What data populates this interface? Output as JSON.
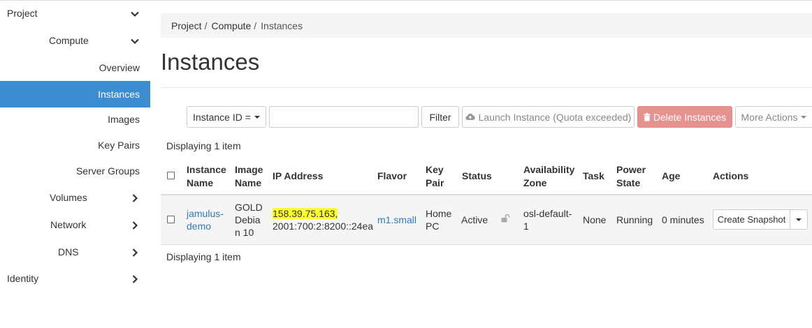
{
  "sidebar": {
    "items": [
      {
        "label": "Project",
        "chevron": "down"
      },
      {
        "label": "Compute",
        "chevron": "down"
      },
      {
        "label": "Overview"
      },
      {
        "label": "Instances",
        "active": true
      },
      {
        "label": "Images"
      },
      {
        "label": "Key Pairs"
      },
      {
        "label": "Server Groups"
      },
      {
        "label": "Volumes",
        "chevron": "right"
      },
      {
        "label": "Network",
        "chevron": "right"
      },
      {
        "label": "DNS",
        "chevron": "right"
      },
      {
        "label": "Identity",
        "chevron": "right"
      }
    ],
    "active_color": "#3c8dd0"
  },
  "breadcrumb": {
    "items": [
      "Project",
      "Compute",
      "Instances"
    ]
  },
  "page": {
    "title": "Instances"
  },
  "toolbar": {
    "filter_field_label": "Instance ID =",
    "search_value": "",
    "filter_label": "Filter",
    "launch_label": "Launch Instance (Quota exceeded)",
    "delete_label": "Delete Instances",
    "more_label": "More Actions",
    "danger_color": "#e6928f"
  },
  "table": {
    "display_top": "Displaying 1 item",
    "display_bottom": "Displaying 1 item",
    "headers": {
      "name_1": "Instance",
      "name_2": "Name",
      "image_1": "Image",
      "image_2": "Name",
      "ip": "IP Address",
      "flavor": "Flavor",
      "keypair_1": "Key",
      "keypair_2": "Pair",
      "status": "Status",
      "zone_1": "Availability",
      "zone_2": "Zone",
      "task": "Task",
      "power_1": "Power",
      "power_2": "State",
      "age": "Age",
      "actions": "Actions"
    },
    "rows": [
      {
        "name_1": "jamulus-",
        "name_2": "demo",
        "image_1": "GOLD",
        "image_2": "Debia",
        "image_3": "n 10",
        "ip_1": "158.39.75.163,",
        "ip_2": "2001:700:2:8200::24ea",
        "flavor": "m1.small",
        "keypair_1": "Home",
        "keypair_2": "PC",
        "status": "Active",
        "status_icon": "unlock-icon",
        "zone_1": "osl-default-",
        "zone_2": "1",
        "task": "None",
        "power": "Running",
        "age": "0 minutes",
        "action_label": "Create Snapshot"
      }
    ]
  }
}
